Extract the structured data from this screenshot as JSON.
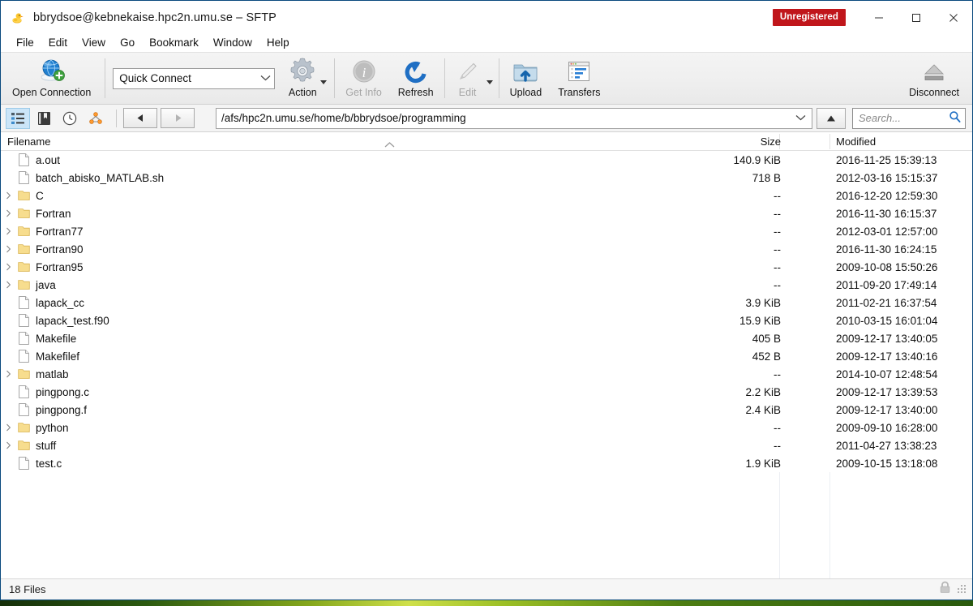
{
  "window": {
    "title": "bbrydsoe@kebnekaise.hpc2n.umu.se – SFTP",
    "app_icon": "duck-icon",
    "badge": "Unregistered",
    "badge_color": "#c0161b",
    "minimize_label": "─",
    "maximize_label": "□",
    "close_label": "✕"
  },
  "menubar": {
    "items": [
      {
        "label": "File"
      },
      {
        "label": "Edit"
      },
      {
        "label": "View"
      },
      {
        "label": "Go"
      },
      {
        "label": "Bookmark"
      },
      {
        "label": "Window"
      },
      {
        "label": "Help"
      }
    ]
  },
  "toolbar": {
    "open_connection": "Open Connection",
    "quick_connect_value": "Quick Connect",
    "quick_connect_placeholder": "Quick Connect",
    "action": "Action",
    "get_info": "Get Info",
    "refresh": "Refresh",
    "edit": "Edit",
    "upload": "Upload",
    "transfers": "Transfers",
    "disconnect": "Disconnect"
  },
  "navbar": {
    "view_browser_icon": "browser-view-icon",
    "bookmarks_icon": "bookmark-icon",
    "history_icon": "history-clock-icon",
    "bonjour_icon": "bonjour-icon",
    "back_label": "◀",
    "forward_label": "▶",
    "path": "/afs/hpc2n.umu.se/home/b/bbrydsoe/programming",
    "up_label": "▲",
    "search_placeholder": "Search...",
    "search_value": ""
  },
  "columns": {
    "filename": "Filename",
    "size": "Size",
    "modified": "Modified",
    "sort_indicator": "⌃"
  },
  "files": [
    {
      "name": "a.out",
      "type": "file",
      "expandable": false,
      "size": "140.9 KiB",
      "modified": "2016-11-25 15:39:13"
    },
    {
      "name": "batch_abisko_MATLAB.sh",
      "type": "file",
      "expandable": false,
      "size": "718 B",
      "modified": "2012-03-16 15:15:37"
    },
    {
      "name": "C",
      "type": "folder",
      "expandable": true,
      "size": "--",
      "modified": "2016-12-20 12:59:30"
    },
    {
      "name": "Fortran",
      "type": "folder",
      "expandable": true,
      "size": "--",
      "modified": "2016-11-30 16:15:37"
    },
    {
      "name": "Fortran77",
      "type": "folder",
      "expandable": true,
      "size": "--",
      "modified": "2012-03-01 12:57:00"
    },
    {
      "name": "Fortran90",
      "type": "folder",
      "expandable": true,
      "size": "--",
      "modified": "2016-11-30 16:24:15"
    },
    {
      "name": "Fortran95",
      "type": "folder",
      "expandable": true,
      "size": "--",
      "modified": "2009-10-08 15:50:26"
    },
    {
      "name": "java",
      "type": "folder",
      "expandable": true,
      "size": "--",
      "modified": "2011-09-20 17:49:14"
    },
    {
      "name": "lapack_cc",
      "type": "file",
      "expandable": false,
      "size": "3.9 KiB",
      "modified": "2011-02-21 16:37:54"
    },
    {
      "name": "lapack_test.f90",
      "type": "file",
      "expandable": false,
      "size": "15.9 KiB",
      "modified": "2010-03-15 16:01:04"
    },
    {
      "name": "Makefile",
      "type": "file",
      "expandable": false,
      "size": "405 B",
      "modified": "2009-12-17 13:40:05"
    },
    {
      "name": "Makefilef",
      "type": "file",
      "expandable": false,
      "size": "452 B",
      "modified": "2009-12-17 13:40:16"
    },
    {
      "name": "matlab",
      "type": "folder",
      "expandable": true,
      "size": "--",
      "modified": "2014-10-07 12:48:54"
    },
    {
      "name": "pingpong.c",
      "type": "file",
      "expandable": false,
      "size": "2.2 KiB",
      "modified": "2009-12-17 13:39:53"
    },
    {
      "name": "pingpong.f",
      "type": "file",
      "expandable": false,
      "size": "2.4 KiB",
      "modified": "2009-12-17 13:40:00"
    },
    {
      "name": "python",
      "type": "folder",
      "expandable": true,
      "size": "--",
      "modified": "2009-09-10 16:28:00"
    },
    {
      "name": "stuff",
      "type": "folder",
      "expandable": true,
      "size": "--",
      "modified": "2011-04-27 13:38:23"
    },
    {
      "name": "test.c",
      "type": "file",
      "expandable": false,
      "size": "1.9 KiB",
      "modified": "2009-10-15 13:18:08"
    }
  ],
  "statusbar": {
    "text": "18 Files",
    "lock_icon": "padlock-icon",
    "resize_grip": "resize-grip"
  },
  "colors": {
    "accent": "#0a4a7e",
    "folder": "#f5d882",
    "badge": "#c0161b",
    "selection": "#cbe5f8"
  }
}
